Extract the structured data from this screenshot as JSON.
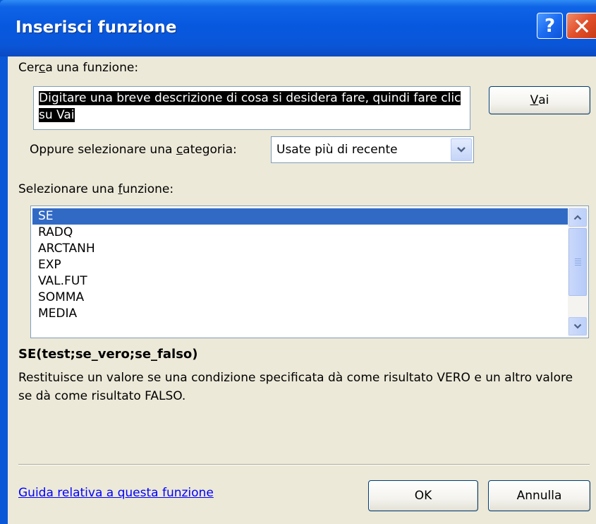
{
  "dialog": {
    "title": "Inserisci funzione",
    "help_button": "?",
    "close_button": "X"
  },
  "search": {
    "label_pre": "Cer",
    "label_u": "c",
    "label_post": "a una funzione:",
    "text": "Digitare una breve descrizione di cosa si desidera fare, quindi fare clic su Vai",
    "go_button_u": "V",
    "go_button_rest": "ai"
  },
  "category": {
    "label_pre": "Oppure selezionare una ",
    "label_u": "c",
    "label_post": "ategoria:",
    "selected": "Usate più di recente"
  },
  "function_list": {
    "label_pre": "Selezionare una ",
    "label_u": "f",
    "label_post": "unzione:",
    "items": [
      "SE",
      "RADQ",
      "ARCTANH",
      "EXP",
      "VAL.FUT",
      "SOMMA",
      "MEDIA"
    ],
    "selected_index": 0
  },
  "details": {
    "syntax": "SE(test;se_vero;se_falso)",
    "description": "Restituisce un valore se una condizione specificata dà come risultato VERO e un altro valore se dà come risultato FALSO."
  },
  "footer": {
    "help_link": "Guida relativa a questa funzione",
    "ok_button": "OK",
    "cancel_button": "Annulla"
  },
  "colors": {
    "title_bar": "#0a58d8",
    "dialog_bg": "#ece9d8",
    "selection": "#316ac5",
    "link": "#0000ff"
  }
}
